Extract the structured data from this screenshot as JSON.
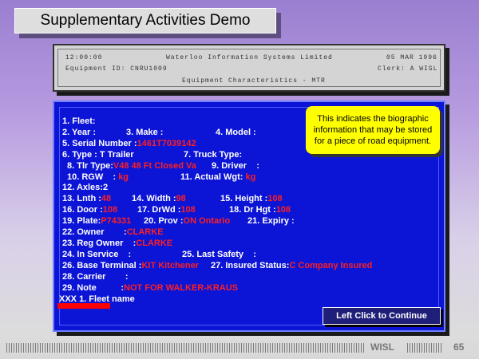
{
  "title": "Supplementary Activities Demo",
  "terminal": {
    "time": "12:00:00",
    "company": "Waterloo Information Systems Limited",
    "date": "05 MAR 1996",
    "equipment_id": "Equipment ID: CNRU1009",
    "clerk": "Clerk: A WISL",
    "screen_title": "Equipment Characteristics - MTR"
  },
  "form": {
    "fleet": "1. Fleet:",
    "year": "2. Year :",
    "make": "3. Make :",
    "model": "4. Model :",
    "serial_label": "5. Serial Number :",
    "serial_value": "1461T7039142",
    "type": "6. Type : T Trailer",
    "truck_type": "7. Truck Type:",
    "tlr_type_label": "8. Tlr Type:",
    "tlr_type_value": "V48 48 Ft Closed Va",
    "driver": "9. Driver    :",
    "rgw_label": "10. RGW    :",
    "rgw_value": "kg",
    "actual_wgt_label": "11. Actual Wgt:",
    "actual_wgt_value": "kg",
    "axles": "12. Axles:2",
    "lnth_label": "13. Lnth :",
    "lnth_value": "48",
    "width_label": "14. Width :",
    "width_value": "98",
    "height_label": "15. Height :",
    "height_value": "108",
    "door_label": "16. Door :",
    "door_value": "108",
    "drwd_label": "17. DrWd :",
    "drwd_value": "108",
    "drhgt_label": "18. Dr Hgt :",
    "drhgt_value": "108",
    "plate_label": "19. Plate:",
    "plate_value": "P74331",
    "prov_label": "20. Prov :",
    "prov_value": "ON Ontario",
    "expiry": "21. Expiry :",
    "owner_label": "22. Owner        :",
    "owner_value": "CLARKE",
    "reg_owner_label": "23. Reg Owner    :",
    "reg_owner_value": "CLARKE",
    "in_service": "24. In Service    :",
    "last_safety": "25. Last Safety    :",
    "base_terminal_label": "26. Base Terminal :",
    "base_terminal_value": "KIT Kitchener",
    "insured_label": "27. Insured Status:",
    "insured_value": "C Company Insured",
    "carrier": "28. Carrier        :",
    "note_label": "29. Note          :",
    "note_value": "NOT FOR WALKER-KRAUS",
    "command_line": "XXX 1. Fleet name"
  },
  "callout": "This indicates the biographic information that may be stored for a piece of road equipment.",
  "continue_label": "Left Click to Continue",
  "footer": {
    "brand": "WISL",
    "page": "65"
  }
}
